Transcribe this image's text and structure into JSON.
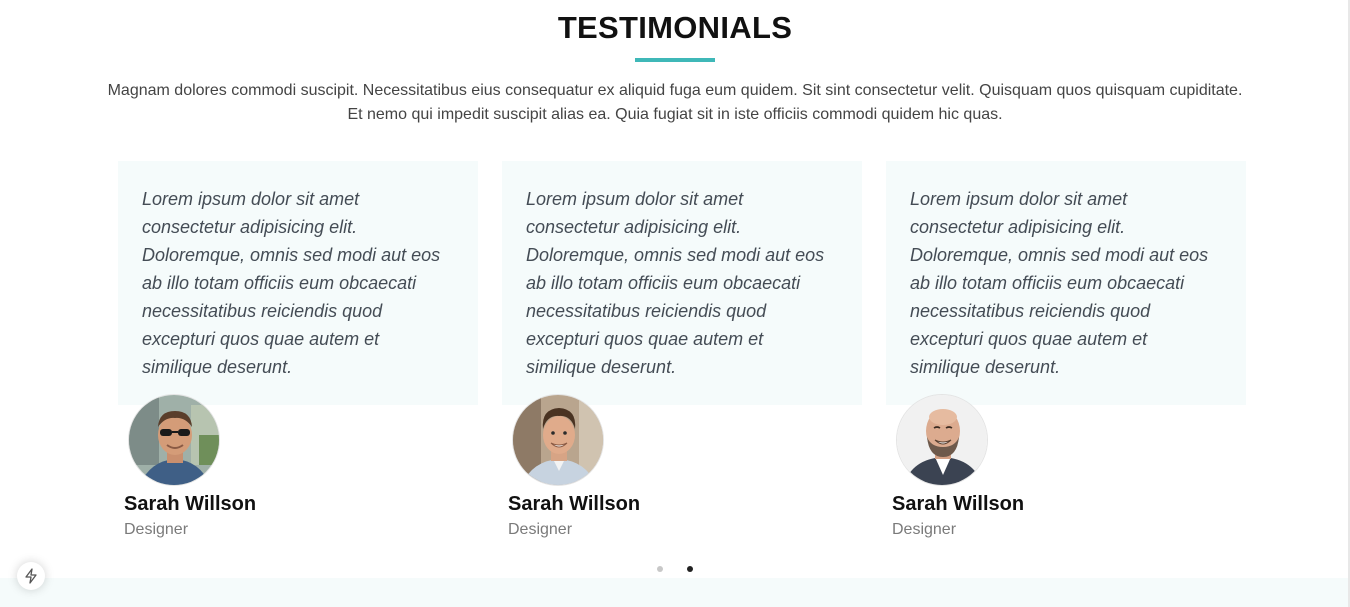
{
  "section": {
    "title": "TESTIMONIALS",
    "description_line1": "Magnam dolores commodi suscipit. Necessitatibus eius consequatur ex aliquid fuga eum quidem. Sit sint consectetur velit. Quisquam quos quisquam cupiditate.",
    "description_line2": "Et nemo qui impedit suscipit alias ea. Quia fugiat sit in iste officiis commodi quidem hic quas."
  },
  "testimonials": [
    {
      "quote": "Lorem ipsum dolor sit amet consectetur adipisicing elit. Doloremque, omnis sed modi aut eos ab illo totam officiis eum obcaecati necessitatibus reiciendis quod excepturi quos quae autem et similique deserunt.",
      "name": "Sarah Willson",
      "role": "Designer",
      "avatar": "man-with-sunglasses-photo"
    },
    {
      "quote": "Lorem ipsum dolor sit amet consectetur adipisicing elit. Doloremque, omnis sed modi aut eos ab illo totam officiis eum obcaecati necessitatibus reiciendis quod excepturi quos quae autem et similique deserunt.",
      "name": "Sarah Willson",
      "role": "Designer",
      "avatar": "smiling-man-photo"
    },
    {
      "quote": "Lorem ipsum dolor sit amet consectetur adipisicing elit. Doloremque, omnis sed modi aut eos ab illo totam officiis eum obcaecati necessitatibus reiciendis quod excepturi quos quae autem et similique deserunt.",
      "name": "Sarah Willson",
      "role": "Designer",
      "avatar": "bald-bearded-man-photo"
    }
  ],
  "carousel": {
    "page_count": 2,
    "active_page": 2
  },
  "floating_button": {
    "icon": "lightning-bolt-icon"
  },
  "colors": {
    "accent": "#3fb8b8",
    "card_background": "#f5fbfb",
    "heading": "#111111",
    "body_text": "#444444",
    "muted_text": "#7a7a7a"
  }
}
